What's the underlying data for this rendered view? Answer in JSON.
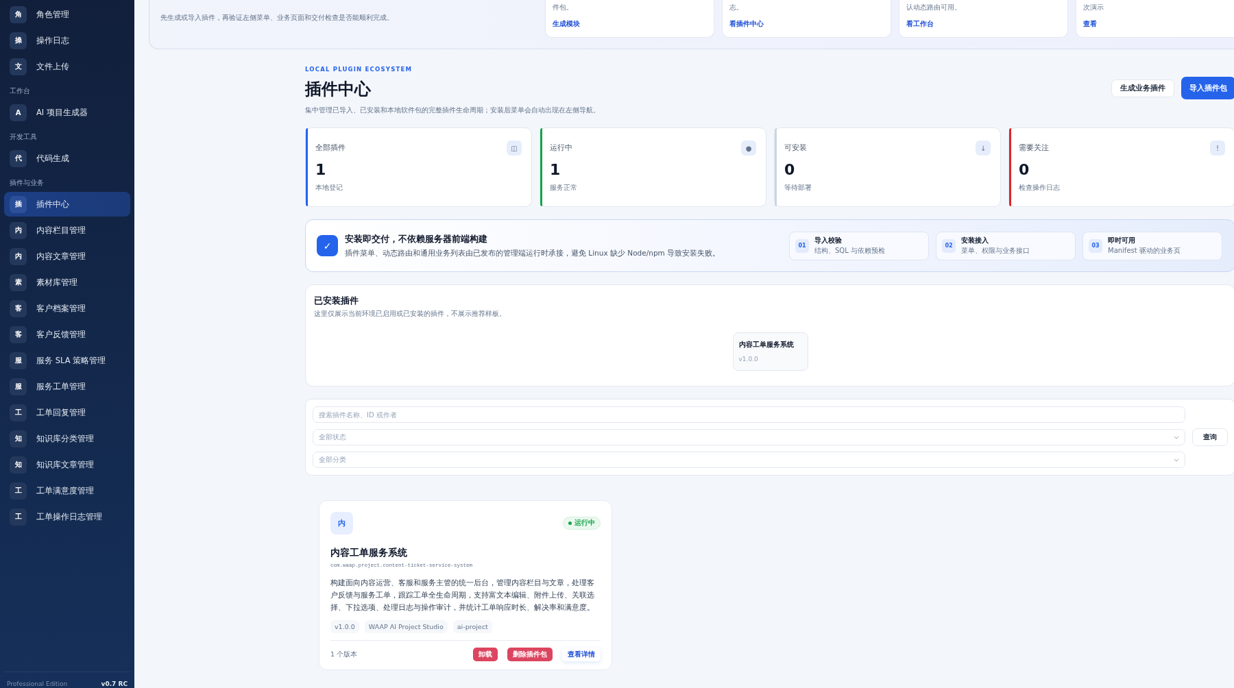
{
  "sidebar": {
    "groups": [
      {
        "items": [
          {
            "icon": "角",
            "label": "角色管理",
            "selected": false
          },
          {
            "icon": "操",
            "label": "操作日志",
            "selected": false
          },
          {
            "icon": "文",
            "label": "文件上传",
            "selected": false
          }
        ]
      },
      {
        "title": "工作台",
        "items": [
          {
            "icon": "A",
            "label": "AI 项目生成器",
            "selected": false
          }
        ]
      },
      {
        "title": "开发工具",
        "items": [
          {
            "icon": "代",
            "label": "代码生成",
            "selected": false
          }
        ]
      },
      {
        "title": "插件与业务",
        "items": [
          {
            "icon": "插",
            "label": "插件中心",
            "selected": true
          },
          {
            "icon": "内",
            "label": "内容栏目管理",
            "selected": false
          },
          {
            "icon": "内",
            "label": "内容文章管理",
            "selected": false
          },
          {
            "icon": "素",
            "label": "素材库管理",
            "selected": false
          },
          {
            "icon": "客",
            "label": "客户档案管理",
            "selected": false
          },
          {
            "icon": "客",
            "label": "客户反馈管理",
            "selected": false
          },
          {
            "icon": "服",
            "label": "服务 SLA 策略管理",
            "selected": false
          },
          {
            "icon": "服",
            "label": "服务工单管理",
            "selected": false
          },
          {
            "icon": "工",
            "label": "工单回复管理",
            "selected": false
          },
          {
            "icon": "知",
            "label": "知识库分类管理",
            "selected": false
          },
          {
            "icon": "知",
            "label": "知识库文章管理",
            "selected": false
          },
          {
            "icon": "工",
            "label": "工单满意度管理",
            "selected": false
          },
          {
            "icon": "工",
            "label": "工单操作日志管理",
            "selected": false
          }
        ]
      }
    ],
    "footer": {
      "edition": "Professional Edition",
      "version": "v0.7 RC"
    }
  },
  "guide": {
    "text": "先生成或导入插件，再验证左侧菜单、业务页面和交付检查是否能顺利完成。",
    "cards": [
      {
        "text": "件包。",
        "link": "生成模块"
      },
      {
        "text": "志。",
        "link": "看插件中心"
      },
      {
        "text": "认动态路由可用。",
        "link": "看工作台"
      },
      {
        "text": "次演示",
        "link": "查看"
      }
    ]
  },
  "header": {
    "eyebrow": "LOCAL PLUGIN ECOSYSTEM",
    "title": "插件中心",
    "subtitle": "集中管理已导入、已安装和本地软件包的完整插件生命周期；安装后菜单会自动出现在左侧导航。",
    "buttons": [
      {
        "label": "生成业务插件",
        "kind": "secondary"
      },
      {
        "label": "导入插件包",
        "kind": "primary"
      }
    ]
  },
  "stats": [
    {
      "label": "全部插件",
      "icon": "◫",
      "value": "1",
      "note": "本地登记",
      "color": "#2563eb"
    },
    {
      "label": "运行中",
      "icon": "●",
      "value": "1",
      "note": "服务正常",
      "color": "#16a34a"
    },
    {
      "label": "可安装",
      "icon": "↓",
      "value": "0",
      "note": "等待部署",
      "color": "#cbd5e1"
    },
    {
      "label": "需要关注",
      "icon": "!",
      "value": "0",
      "note": "检查操作日志",
      "color": "#dc2626"
    }
  ],
  "delivery": {
    "icon": "✓",
    "title": "安装即交付，不依赖服务器前端构建",
    "text": "插件菜单、动态路由和通用业务列表由已发布的管理端运行时承接，避免 Linux 缺少 Node/npm 导致安装失败。",
    "steps": [
      {
        "number": "01",
        "title": "导入校验",
        "text": "结构、SQL 与依赖预检"
      },
      {
        "number": "02",
        "title": "安装接入",
        "text": "菜单、权限与业务接口"
      },
      {
        "number": "03",
        "title": "即时可用",
        "text": "Manifest 驱动的业务页"
      }
    ]
  },
  "installed": {
    "title": "已安装插件",
    "subtitle": "这里仅展示当前环境已启用或已安装的插件，不展示推荐样板。",
    "items": [
      {
        "name": "内容工单服务系统",
        "version": "v1.0.0"
      }
    ]
  },
  "filters": {
    "search": {
      "placeholder": "搜索插件名称、ID 或作者"
    },
    "status": {
      "value": "全部状态"
    },
    "category": {
      "value": "全部分类"
    },
    "query": "查询"
  },
  "plugins": [
    {
      "icon": "内",
      "status": "运行中",
      "color": "#16a34a",
      "name": "内容工单服务系统",
      "id": "com.waap.project.content-ticket-service-system",
      "description": "构建面向内容运营、客服和服务主管的统一后台，管理内容栏目与文章，处理客户反馈与服务工单，跟踪工单全生命周期，支持富文本编辑、附件上传、关联选择、下拉选项、处理日志与操作审计，并统计工单响应时长、解决率和满意度。",
      "tags": [
        "v1.0.0",
        "WAAP AI Project Studio",
        "ai-project"
      ],
      "versions": "1 个版本",
      "actions": [
        {
          "label": "卸载",
          "kind": "danger"
        },
        {
          "label": "删除插件包",
          "kind": "danger"
        },
        {
          "label": "查看详情",
          "kind": "link"
        }
      ]
    }
  ]
}
